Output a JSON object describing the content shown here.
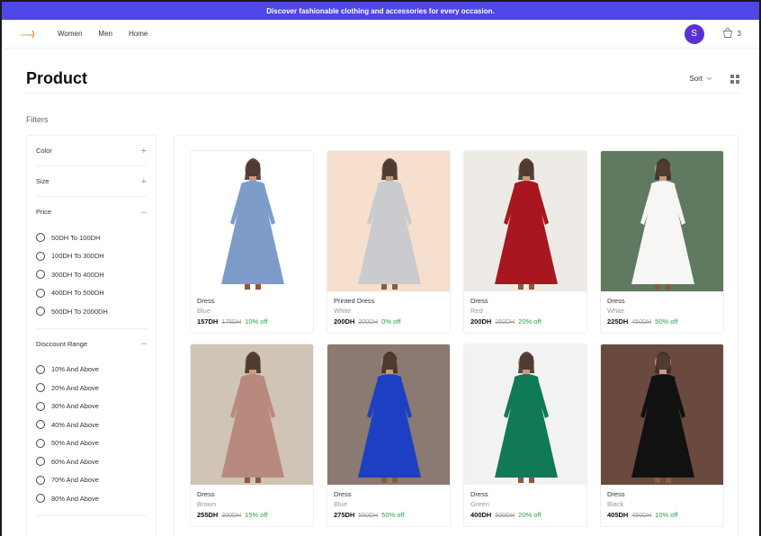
{
  "banner": {
    "text": "Discover fashionable clothing and accessories for every occasion."
  },
  "nav": {
    "logo_text": "Crème",
    "links": [
      "Women",
      "Men",
      "Home"
    ],
    "avatar_initial": "S",
    "cart_count": "3"
  },
  "page": {
    "title": "Product",
    "sort_label": "Sort"
  },
  "filters": {
    "label": "Filters",
    "color_label": "Color",
    "size_label": "Size",
    "price_label": "Price",
    "price_options": [
      "50DH To 100DH",
      "100DH To 300DH",
      "300DH To 400DH",
      "400DH To 500DH",
      "500DH To 2000DH"
    ],
    "discount_label": "Disccount Range",
    "discount_options": [
      "10% And Above",
      "20% And Above",
      "30% And Above",
      "40% And Above",
      "50% And Above",
      "60% And Above",
      "70% And Above",
      "80% And Above"
    ]
  },
  "products": [
    {
      "type": "Dress",
      "color": "Blue",
      "price": "157DH",
      "old_price": "175DH",
      "discount": "10% off",
      "dress_color": "#7d9cc9",
      "bg": "#ffffff"
    },
    {
      "type": "Printed Dress",
      "color": "White",
      "price": "200DH",
      "old_price": "200DH",
      "discount": "0% off",
      "dress_color": "#c9cbce",
      "bg": "#f6dfcc"
    },
    {
      "type": "Dress",
      "color": "Red",
      "price": "200DH",
      "old_price": "250DH",
      "discount": "20% off",
      "dress_color": "#a8161f",
      "bg": "#eeeae5"
    },
    {
      "type": "Dress",
      "color": "White",
      "price": "225DH",
      "old_price": "450DH",
      "discount": "50% off",
      "dress_color": "#f6f6f4",
      "bg": "#5f7a60"
    },
    {
      "type": "Dress",
      "color": "Brown",
      "price": "255DH",
      "old_price": "300DH",
      "discount": "15% off",
      "dress_color": "#b88a7e",
      "bg": "#cfc4b6"
    },
    {
      "type": "Dress",
      "color": "Blue",
      "price": "275DH",
      "old_price": "550DH",
      "discount": "50% off",
      "dress_color": "#1d3fc1",
      "bg": "#8a7a72"
    },
    {
      "type": "Dress",
      "color": "Green",
      "price": "400DH",
      "old_price": "500DH",
      "discount": "20% off",
      "dress_color": "#0f7a55",
      "bg": "#f2f2f2"
    },
    {
      "type": "Dress",
      "color": "Black",
      "price": "405DH",
      "old_price": "450DH",
      "discount": "10% off",
      "dress_color": "#111111",
      "bg": "#6a4a3e"
    }
  ]
}
